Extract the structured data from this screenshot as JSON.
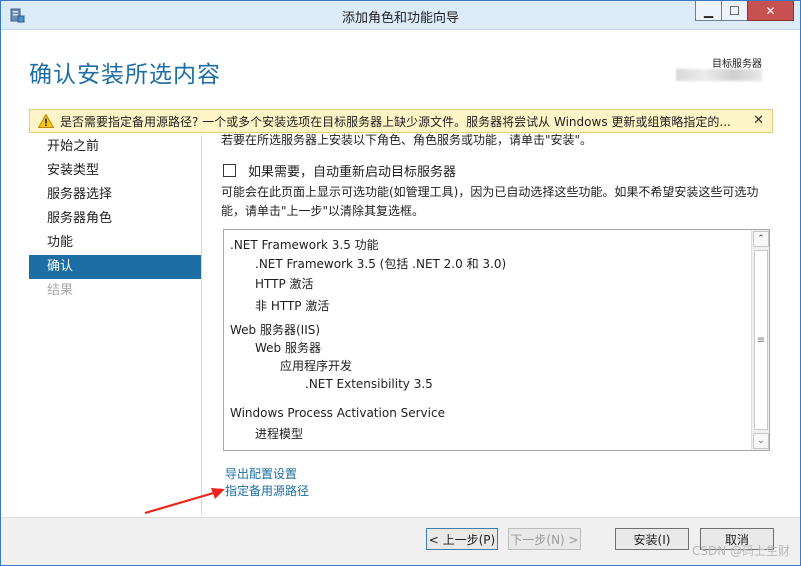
{
  "window": {
    "title": "添加角色和功能向导",
    "minimize": "▁",
    "maximize": "☐",
    "close": "✕"
  },
  "header": {
    "page_title": "确认安装所选内容",
    "target_label": "目标服务器"
  },
  "warning": {
    "text": "是否需要指定备用源路径? 一个或多个安装选项在目标服务器上缺少源文件。服务器将尝试从 Windows 更新或组策略指定的...",
    "close": "✕",
    "icon": "warning-triangle-icon",
    "color": "#fdf5c8"
  },
  "nav": {
    "items": [
      {
        "label": "开始之前",
        "state": "normal"
      },
      {
        "label": "安装类型",
        "state": "normal"
      },
      {
        "label": "服务器选择",
        "state": "normal"
      },
      {
        "label": "服务器角色",
        "state": "normal"
      },
      {
        "label": "功能",
        "state": "normal"
      },
      {
        "label": "确认",
        "state": "active"
      },
      {
        "label": "结果",
        "state": "disabled"
      }
    ],
    "active_color": "#1c6ea4"
  },
  "content": {
    "intro": "若要在所选服务器上安装以下角色、角色服务或功能，请单击\"安装\"。",
    "restart_label": "如果需要，自动重新启动目标服务器",
    "restart_checked": false,
    "note": "可能会在此页面上显示可选功能(如管理工具)，因为已自动选择这些功能。如果不希望安装这些可选功能，请单击\"上一步\"以清除其复选框。"
  },
  "features": [
    {
      "label": ".NET Framework 3.5 功能",
      "level": 0
    },
    {
      "label": ".NET Framework 3.5 (包括 .NET 2.0 和 3.0)",
      "level": 1
    },
    {
      "label": "HTTP 激活",
      "level": 1
    },
    {
      "label": "非 HTTP 激活",
      "level": 1
    },
    {
      "label": "Web 服务器(IIS)",
      "level": 0
    },
    {
      "label": "Web 服务器",
      "level": 1
    },
    {
      "label": "应用程序开发",
      "level": 2
    },
    {
      "label": ".NET Extensibility 3.5",
      "level": 3
    },
    {
      "label": "Windows Process Activation Service",
      "level": 0
    },
    {
      "label": "进程模型",
      "level": 1
    }
  ],
  "scrollbar": {
    "up": "⌃",
    "down": "⌄",
    "grip": "≡"
  },
  "links": {
    "export": "导出配置设置",
    "alternate_source": "指定备用源路径"
  },
  "buttons": {
    "prev": "< 上一步(P)",
    "next": "下一步(N) >",
    "install": "安装(I)",
    "cancel": "取消"
  },
  "watermark": "CSDN @码上生财"
}
